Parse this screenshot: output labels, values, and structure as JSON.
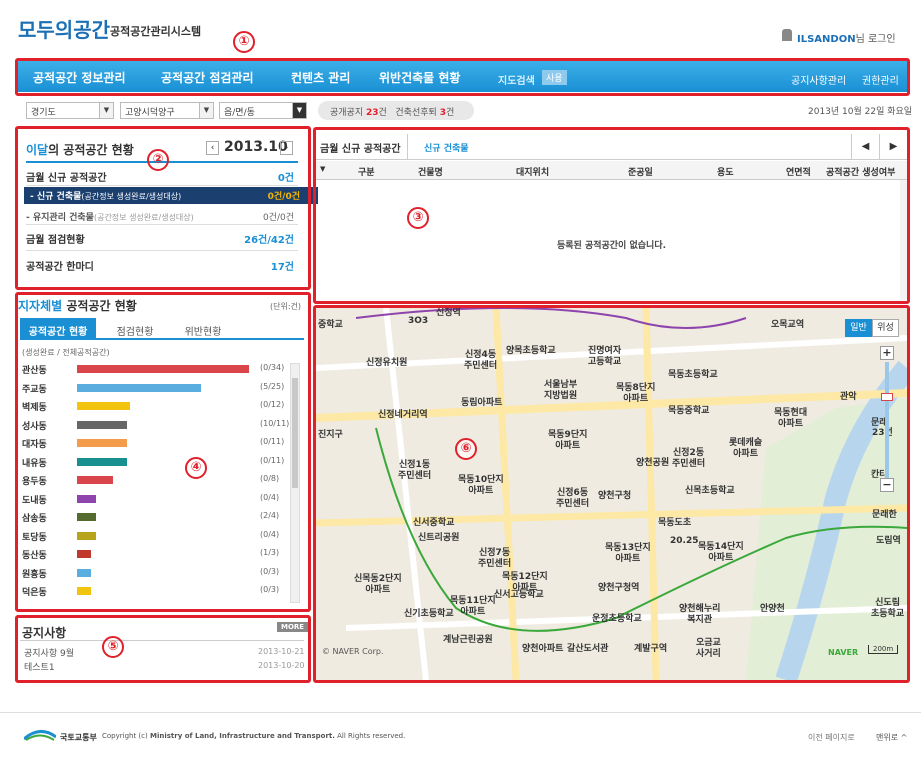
{
  "header": {
    "logo_text": "모두의공간",
    "logo_highlight": "의",
    "system_title": "공적공간관리시스템",
    "user": "ILSANDON",
    "user_suffix": "님 로그인"
  },
  "nav": {
    "items": [
      "공적공간 정보관리",
      "공적공간 점검관리",
      "컨텐츠 관리",
      "위반건축물 현황"
    ],
    "map_search": "지도검색",
    "map_badge": "사용",
    "right": [
      "공지사항관리",
      "권한관리"
    ]
  },
  "filters": {
    "province": "경기도",
    "city": "고양시덕양구",
    "town": "읍/면/동",
    "pill_label1": "공개공지",
    "pill_val1": "23",
    "pill_unit1": "건",
    "pill_label2": "건축선후퇴",
    "pill_val2": "3",
    "pill_unit2": "건",
    "date": "2013년 10월 22일 화요일"
  },
  "panel2": {
    "title_b": "이달",
    "title_rest": "의 공적공간 현황",
    "year_month": "2013.10",
    "rows": [
      {
        "label": "금월 신규 공적공간",
        "value": "0건"
      },
      {
        "label": "- 신규 건축물",
        "sub": "(공간정보 생성완료/생성대상)",
        "value": "0건/0건"
      },
      {
        "label": "- 유지관리 건축물",
        "sub": "(공간정보 생성완료/생성대상)",
        "value": "0건/0건"
      },
      {
        "label": "금월 점검현황",
        "value": "26건/42건"
      },
      {
        "label": "공적공간 한마디",
        "value": "17건"
      }
    ]
  },
  "panel4": {
    "title_b": "지자체별",
    "title_rest": " 공적공간 현황",
    "unit": "(단위:건)",
    "tabs": [
      "공적공간 현황",
      "점검현황",
      "위반현황"
    ],
    "legend": "(생성완료 / 전체공적공간)",
    "rows": [
      {
        "name": "관산동",
        "count": "(0/34)",
        "color": "#d9454a",
        "frac": 1.0
      },
      {
        "name": "주교동",
        "count": "(5/25)",
        "color": "#5aaedf",
        "frac": 0.72
      },
      {
        "name": "벽제동",
        "count": "(0/12)",
        "color": "#f1c40f",
        "frac": 0.31
      },
      {
        "name": "성사동",
        "count": "(10/11)",
        "color": "#666666",
        "frac": 0.29
      },
      {
        "name": "대자동",
        "count": "(0/11)",
        "color": "#f39c4a",
        "frac": 0.29
      },
      {
        "name": "내유동",
        "count": "(0/11)",
        "color": "#1a8f8f",
        "frac": 0.29
      },
      {
        "name": "용두동",
        "count": "(0/8)",
        "color": "#d9454a",
        "frac": 0.21
      },
      {
        "name": "도내동",
        "count": "(0/4)",
        "color": "#8e44ad",
        "frac": 0.11
      },
      {
        "name": "삼송동",
        "count": "(2/4)",
        "color": "#556b2f",
        "frac": 0.11
      },
      {
        "name": "토당동",
        "count": "(0/4)",
        "color": "#b7a41a",
        "frac": 0.11
      },
      {
        "name": "동산동",
        "count": "(1/3)",
        "color": "#c0392b",
        "frac": 0.08
      },
      {
        "name": "원흥동",
        "count": "(0/3)",
        "color": "#5aaedf",
        "frac": 0.08
      },
      {
        "name": "덕은동",
        "count": "(0/3)",
        "color": "#f1c40f",
        "frac": 0.08
      }
    ]
  },
  "panel3": {
    "tab_main": "금월 신규 공적공간",
    "tab_sub": "신규 건축물",
    "columns": [
      "구분",
      "건물명",
      "대지위치",
      "준공일",
      "용도",
      "연면적",
      "공적공간 생성여부"
    ],
    "empty": "등록된 공적공간이 없습니다."
  },
  "map": {
    "btn_normal": "일반",
    "btn_sat": "위성",
    "copyright": "© NAVER Corp.",
    "naver": "NAVER",
    "scale": "200m",
    "labels": [
      {
        "t": "신정역"
      },
      {
        "t": "오목교역"
      },
      {
        "t": "중학교"
      },
      {
        "t": "신정유치원"
      },
      {
        "t": "신정4동\n주민센터"
      },
      {
        "t": "양목초등학교"
      },
      {
        "t": "진명여자\n고등학교"
      },
      {
        "t": "목동초등학교"
      },
      {
        "t": "목동8단지\n아파트"
      },
      {
        "t": "서울남부\n지방법원"
      },
      {
        "t": "동림아파트"
      },
      {
        "t": "목동중학교"
      },
      {
        "t": "목동현대\n아파트"
      },
      {
        "t": "신정네거리역"
      },
      {
        "t": "목동9단지\n아파트"
      },
      {
        "t": "신정2동\n주민센터"
      },
      {
        "t": "롯데캐슬\n아파트"
      },
      {
        "t": "진지구"
      },
      {
        "t": "신정1동\n주민센터"
      },
      {
        "t": "목동10단지\n아파트"
      },
      {
        "t": "신정6동\n주민센터"
      },
      {
        "t": "양천구청"
      },
      {
        "t": "양천공원"
      },
      {
        "t": "신목초등학교"
      },
      {
        "t": "신서중학교"
      },
      {
        "t": "신트리공원"
      },
      {
        "t": "신정7동\n주민센터"
      },
      {
        "t": "목동13단지\n아파트"
      },
      {
        "t": "목동14단지\n아파트"
      },
      {
        "t": "목동12단지\n아파트"
      },
      {
        "t": "신목동2단지\n아파트"
      },
      {
        "t": "신서고등학교"
      },
      {
        "t": "목동11단지\n아파트"
      },
      {
        "t": "양천구청역"
      },
      {
        "t": "신기초등학교"
      },
      {
        "t": "운정초등학교"
      },
      {
        "t": "양천해누리\n복지관"
      },
      {
        "t": "계남근린공원"
      },
      {
        "t": "양천아파트"
      },
      {
        "t": "갈산도서관"
      },
      {
        "t": "신도림\n초등학교"
      },
      {
        "t": "도림역"
      },
      {
        "t": "관악"
      },
      {
        "t": "문래"
      },
      {
        "t": "안양천"
      },
      {
        "t": "23번"
      },
      {
        "t": "칸타"
      },
      {
        "t": "문래한"
      },
      {
        "t": "오금교\n사거리"
      },
      {
        "t": "계발구역"
      },
      {
        "t": "목동도초"
      },
      {
        "t": "3O3"
      },
      {
        "t": "20.25"
      }
    ]
  },
  "notice": {
    "title": "공지사항",
    "more": "MORE",
    "items": [
      {
        "text": "공지사항 9월",
        "date": "2013-10-21"
      },
      {
        "text": "테스트1",
        "date": "2013-10-20"
      }
    ]
  },
  "footer": {
    "ministry": "국토교통부",
    "copyright_prefix": "Copyright (c)",
    "copyright_strong": "Ministry of Land, Infrastructure and Transport.",
    "copyright_suffix": "All Rights reserved.",
    "prev": "이전 페이지로",
    "top": "맨위로"
  },
  "annotations": [
    "①",
    "②",
    "③",
    "④",
    "⑤",
    "⑥"
  ]
}
